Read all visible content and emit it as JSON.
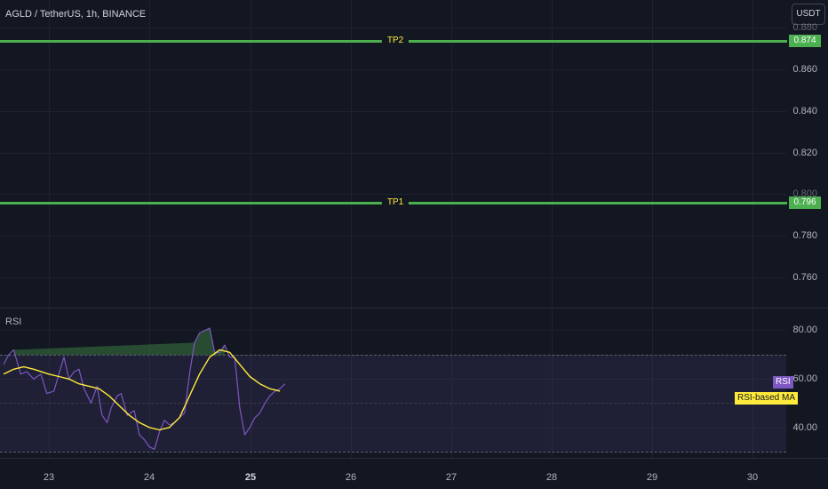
{
  "header": {
    "symbol_title": "AGLD / TetherUS, 1h, BINANCE",
    "currency_button": "USDT"
  },
  "main_axis": {
    "ticks": [
      "0.880",
      "0.860",
      "0.840",
      "0.820",
      "0.800",
      "0.780",
      "0.760"
    ]
  },
  "take_profit": [
    {
      "label": "TP2",
      "price": "0.874",
      "color": "#4caf50"
    },
    {
      "label": "TP1",
      "price": "0.796",
      "color": "#4caf50"
    }
  ],
  "rsi_pane": {
    "title": "RSI",
    "axis_ticks": [
      "80.00",
      "60.00",
      "40.00"
    ],
    "tag_rsi": "RSI",
    "tag_ma": "RSI-based MA",
    "rsi_color": "#7e57c2",
    "ma_color": "#ffeb3b"
  },
  "time_axis": {
    "labels": [
      {
        "text": "23",
        "bold": false
      },
      {
        "text": "24",
        "bold": false
      },
      {
        "text": "25",
        "bold": true
      },
      {
        "text": "26",
        "bold": false
      },
      {
        "text": "27",
        "bold": false
      },
      {
        "text": "28",
        "bold": false
      },
      {
        "text": "29",
        "bold": false
      },
      {
        "text": "30",
        "bold": false
      }
    ]
  },
  "chart_data": {
    "type": "line",
    "series": [
      {
        "name": "RSI",
        "x": [
          22.55,
          22.6,
          22.65,
          22.72,
          22.78,
          22.85,
          22.92,
          22.98,
          23.05,
          23.1,
          23.15,
          23.2,
          23.25,
          23.3,
          23.35,
          23.42,
          23.48,
          23.53,
          23.58,
          23.62,
          23.68,
          23.72,
          23.78,
          23.85,
          23.9,
          23.95,
          24.0,
          24.05,
          24.1,
          24.15,
          24.2,
          24.25,
          24.3,
          24.35,
          24.4,
          24.45,
          24.5,
          24.55,
          24.6,
          24.65,
          24.7,
          24.75,
          24.8,
          24.85,
          24.9,
          24.95,
          25.0,
          25.05,
          25.1,
          25.15,
          25.2,
          25.25,
          25.3,
          25.35
        ],
        "values": [
          66,
          70,
          72,
          62,
          63,
          60,
          62,
          54,
          55,
          62,
          69,
          60,
          63,
          64,
          56,
          50,
          57,
          45,
          42,
          48,
          53,
          54,
          45,
          47,
          37,
          35,
          32,
          31,
          38,
          43,
          41,
          42,
          44,
          46,
          62,
          75,
          79,
          80,
          81,
          71,
          71,
          74,
          69,
          69,
          48,
          37,
          40,
          44,
          46,
          50,
          53,
          55,
          56,
          58
        ]
      },
      {
        "name": "RSI-based MA",
        "x": [
          22.55,
          22.65,
          22.75,
          22.85,
          23.0,
          23.1,
          23.2,
          23.3,
          23.4,
          23.5,
          23.6,
          23.7,
          23.8,
          23.9,
          24.0,
          24.1,
          24.2,
          24.3,
          24.4,
          24.5,
          24.6,
          24.7,
          24.8,
          24.9,
          25.0,
          25.1,
          25.2,
          25.3
        ],
        "values": [
          62,
          64,
          65,
          64,
          62,
          61,
          60,
          58,
          57,
          56,
          53,
          49,
          45,
          42,
          40,
          39,
          40,
          44,
          53,
          62,
          69,
          72,
          71,
          66,
          61,
          58,
          56,
          55
        ]
      }
    ],
    "ylim": [
      30,
      80
    ],
    "xlim": [
      22.55,
      30.35
    ],
    "overbought": 70,
    "oversold": 30,
    "midline": 50
  }
}
